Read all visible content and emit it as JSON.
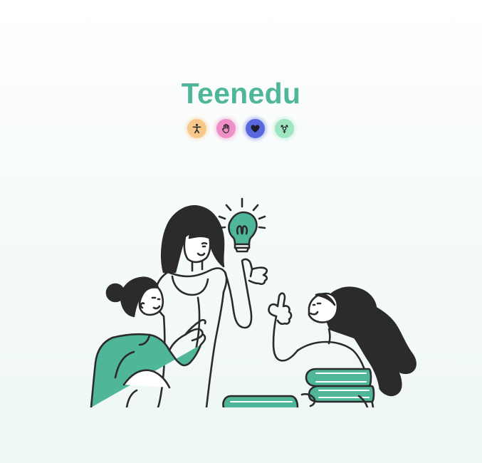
{
  "brand": {
    "name": "Teenedu"
  },
  "badges": [
    {
      "icon": "accessibility-person-icon",
      "color": "#f7c88a"
    },
    {
      "icon": "raised-hand-icon",
      "color": "#ee8fc7"
    },
    {
      "icon": "heart-icon",
      "color": "#5a68e0"
    },
    {
      "icon": "gender-symbol-icon",
      "color": "#9fe6c0"
    }
  ],
  "colors": {
    "accent": "#4fb69a",
    "ink": "#2b2b2b"
  }
}
